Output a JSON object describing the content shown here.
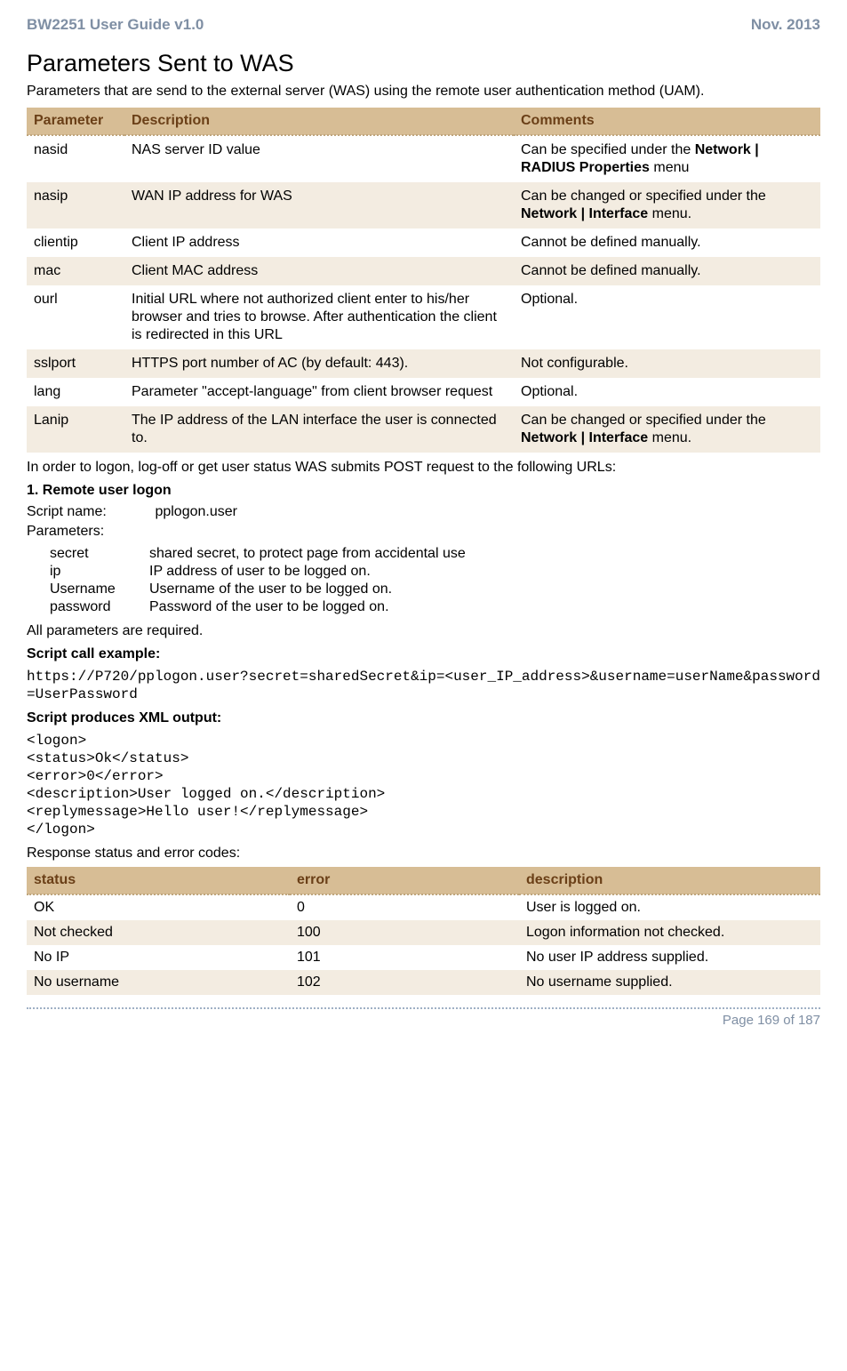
{
  "header": {
    "left": "BW2251 User Guide v1.0",
    "right": "Nov.  2013"
  },
  "title": "Parameters Sent to WAS",
  "intro": "Parameters that are send to the external server (WAS) using the remote user authentication method (UAM).",
  "params_table": {
    "headers": {
      "c1": "Parameter",
      "c2": "Description",
      "c3": "Comments"
    },
    "rows": [
      {
        "p": "nasid",
        "d": "NAS server ID value",
        "c_pre": "Can be specified under the ",
        "c_bold": "Network | RADIUS Properties",
        "c_post": " menu"
      },
      {
        "p": "nasip",
        "d": "WAN IP address for WAS",
        "c_pre": "Can be changed or specified under the ",
        "c_bold": "Network | Interface",
        "c_post": " menu."
      },
      {
        "p": "clientip",
        "d": "Client IP address",
        "c_pre": "Cannot be defined manually.",
        "c_bold": "",
        "c_post": ""
      },
      {
        "p": "mac",
        "d": "Client MAC address",
        "c_pre": "Cannot be defined manually.",
        "c_bold": "",
        "c_post": ""
      },
      {
        "p": "ourl",
        "d": "Initial URL where not authorized client enter to his/her browser and tries to browse. After authentication the client is redirected in this URL",
        "c_pre": "Optional.",
        "c_bold": "",
        "c_post": ""
      },
      {
        "p": "sslport",
        "d": "HTTPS port number of AC (by default: 443).",
        "c_pre": "Not configurable.",
        "c_bold": "",
        "c_post": ""
      },
      {
        "p": "lang",
        "d": "Parameter \"accept-language\" from client browser request",
        "c_pre": "Optional.",
        "c_bold": "",
        "c_post": ""
      },
      {
        "p": "Lanip",
        "d": "The IP address of the LAN interface the user is connected to.",
        "c_pre": "Can be changed or specified under the ",
        "c_bold": "Network | Interface",
        "c_post": " menu."
      }
    ]
  },
  "after_table": "In order to logon, log-off or get user status WAS submits POST request to the following URLs:",
  "section1": {
    "heading": "1. Remote user logon",
    "script_label": "Script name:",
    "script_value": "pplogon.user",
    "params_label": "Parameters:",
    "params": [
      {
        "k": "secret",
        "v": "shared secret, to protect page from accidental use"
      },
      {
        "k": "ip",
        "v": "IP address of user to be logged on."
      },
      {
        "k": "Username",
        "v": "Username of the user to be logged on."
      },
      {
        "k": "password",
        "v": "Password of the user to be logged on."
      }
    ],
    "all_required": "All parameters are required.",
    "call_heading": "Script call example:",
    "call_code": "https://P720/pplogon.user?secret=sharedSecret&ip=<user_IP_address>&username=userName&password=UserPassword",
    "xml_heading": "Script produces XML output:",
    "xml_code": "<logon>\n<status>Ok</status>\n<error>0</error>\n<description>User logged on.</description>\n<replymessage>Hello user!</replymessage>\n</logon>",
    "resp_heading": "Response status and error codes:"
  },
  "status_table": {
    "headers": {
      "c1": "status",
      "c2": "error",
      "c3": "description"
    },
    "rows": [
      {
        "s": "OK",
        "e": "0",
        "d": "User is logged on."
      },
      {
        "s": "Not checked",
        "e": "100",
        "d": "Logon information not checked."
      },
      {
        "s": "No IP",
        "e": "101",
        "d": "No user IP address supplied."
      },
      {
        "s": "No username",
        "e": "102",
        "d": "No username supplied."
      }
    ]
  },
  "footer": "Page 169 of 187"
}
